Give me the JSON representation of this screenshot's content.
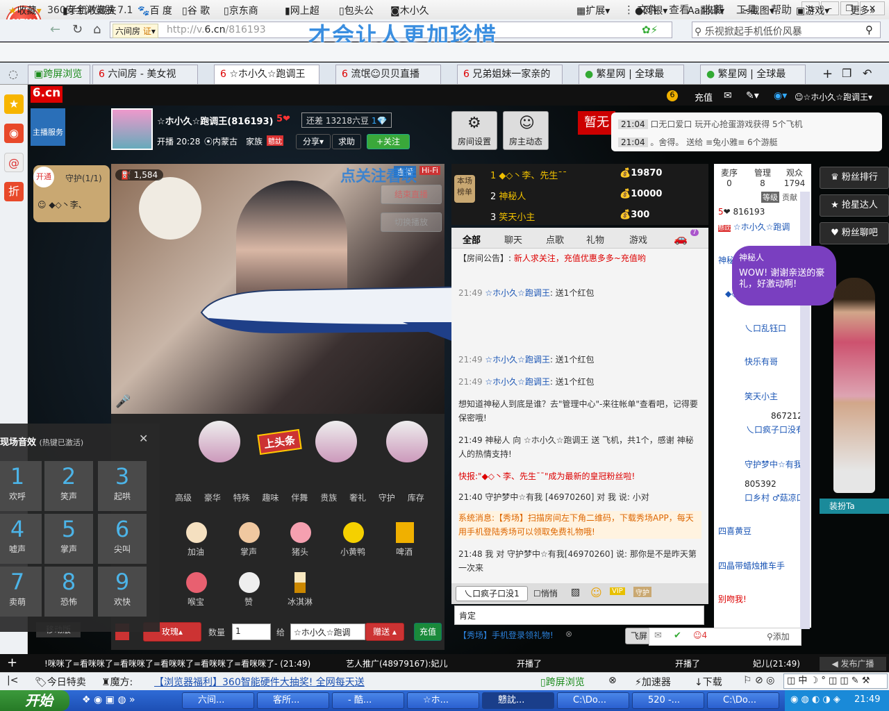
{
  "browser": {
    "title": "360安全浏览器 7.1",
    "logo": "NEW",
    "menus": [
      "文件",
      "查看",
      "收藏",
      "工具",
      "帮助"
    ],
    "url_prefix": "http://v.",
    "url_domain": "6.cn",
    "url_path": "/816193",
    "overlay_text": "才会让人更加珍惜",
    "badge": "六间房",
    "badge_cert": "证",
    "search_placeholder": "乐视掀起手机低价风暴"
  },
  "bookmarks": {
    "left": [
      "收藏",
      "手机收藏夹",
      "百 度",
      "谷 歌",
      "京东商",
      "网上超",
      "包头公",
      "木小久"
    ],
    "right": [
      "扩展",
      "网银",
      "翻译",
      "截图",
      "游戏",
      "更多"
    ]
  },
  "tabs": [
    {
      "label": "跨屏浏览"
    },
    {
      "label": "六间房 - 美女视"
    },
    {
      "label": "☆ホ小久☆跑调王"
    },
    {
      "label": "流氓☺贝贝直播"
    },
    {
      "label": "兄弟姐妹一家亲的"
    },
    {
      "label": "繁星网 | 全球最"
    },
    {
      "label": "繁星网 | 全球最"
    }
  ],
  "site": {
    "logo": "6.cn",
    "logo_sub": "六间房",
    "coin": "6",
    "topup": "充值",
    "user": "☆ホ小久☆跑调王",
    "anchor_service": "主播服务"
  },
  "host": {
    "name": "☆ホ小久☆跑调王(816193)",
    "level": "5",
    "gap_label": "还差",
    "gap_value": "13218",
    "gap_unit": "六豆",
    "gap_level": "1",
    "live_time": "开播 20:28",
    "location": "内蒙古",
    "family": "家族",
    "family_badge": "戆訦",
    "share": "分享",
    "help": "求助",
    "follow": "+关注",
    "room_settings": "房间设置",
    "host_feed": "房主动态"
  },
  "guard": {
    "open": "开通",
    "label": "守护(1/1)",
    "member": "◆◇丶李、"
  },
  "video": {
    "viewers": "1,584",
    "live": "直播",
    "hifi": "Hi-Fi",
    "follow_hint": "点关注看联",
    "btn1": "结束直播",
    "btn2": "切换播放"
  },
  "broadcast": {
    "badge": "暂无",
    "items": [
      {
        "time": "21:04",
        "text": "口无口爱口 玩开心抢蛋游戏获得 5个飞机"
      },
      {
        "time": "21:04",
        "text": "。舍得。 送给 ≡兔小雅≡ 6个游艇"
      }
    ]
  },
  "rank": {
    "label": "本场榜单",
    "rows": [
      {
        "rank": "1",
        "name": "◆◇丶李、先生¯¯",
        "score": "19870"
      },
      {
        "rank": "2",
        "name": "神秘人",
        "score": "10000"
      },
      {
        "rank": "3",
        "name": "笑天小主",
        "score": "300"
      }
    ]
  },
  "chat": {
    "tabs": [
      "全部",
      "聊天",
      "点歌",
      "礼物",
      "游戏"
    ],
    "car_count": "7",
    "notice_label": "【房间公告】:",
    "notice": "新人求关注，充值优惠多多~充值哟",
    "messages": [
      {
        "time": "21:49",
        "user": "☆ホ小久☆跑调王",
        "text": ": 送1个红包"
      },
      {
        "time": "21:49",
        "user": "☆ホ小久☆跑调王",
        "text": ": 送1个红包"
      },
      {
        "time": "21:49",
        "user": "☆ホ小久☆跑调王",
        "text": ": 送1个红包"
      }
    ],
    "sys1": "想知道神秘人到底是谁？去\"管理中心\"-来往帐单\"查看吧，记得要保密哦!",
    "gift_msg": "21:49  神秘人 向 ☆ホ小久☆跑调王 送 飞机，共1个，感谢 神秘人的热情支持!",
    "flash": "快报:\"◆◇丶李、先生¯¯\"成为最新的皇冠粉丝啦!",
    "m2": "21:40  守护梦中☆有我 [46970260] 对 我 说: 小对",
    "sys2": "系统消息:【秀场】扫描房间左下角二维码，下载秀场APP，每天用手机登陆秀场可以领取免费礼物哦!",
    "m3": "21:48  我 对 守护梦中☆有我[46970260] 说: 那你是不是昨天第一次来",
    "target": "乀口疯子口没1",
    "whisper": "悄悄",
    "input": "肯定",
    "promo": "【秀场】手机登录领礼物!",
    "send": "飞屏",
    "count": "4",
    "add": "添加"
  },
  "users": {
    "tabs": [
      {
        "label": "麦序",
        "count": "0"
      },
      {
        "label": "管理",
        "count": "8"
      },
      {
        "label": "观众",
        "count": "1794"
      }
    ],
    "level": "等级",
    "contrib": "贡献",
    "list": [
      {
        "lvl": "5",
        "name": "816193"
      },
      {
        "name": "☆ホ小久☆跑调"
      },
      {
        "name": "神秘人"
      },
      {
        "name": "◆◇丶李、先生"
      },
      {
        "name": "乀口乱钰口"
      },
      {
        "name": "快乐有哥"
      },
      {
        "name": "笑天小主"
      },
      {
        "name": "867212"
      },
      {
        "name": "乀口疯子口没有"
      },
      {
        "name": "守护梦中☆有我"
      },
      {
        "name": "805392"
      },
      {
        "name": "口乡村 ♂菇凉口"
      },
      {
        "name": "四喜黄豆"
      },
      {
        "name": "四晶带蜡烛推车手"
      },
      {
        "name": "别吻我!"
      }
    ]
  },
  "bubble": {
    "who": "神秘人",
    "text": "WOW! 谢谢亲送的豪礼，好激动啊!"
  },
  "fans": {
    "items": [
      "粉丝排行",
      "抢星达人",
      "粉丝聊吧"
    ],
    "dress": "装扮Ta"
  },
  "gifts": {
    "headline": "上头条",
    "cats": [
      "高级",
      "豪华",
      "特殊",
      "趣味",
      "伴舞",
      "贵族",
      "奢礼",
      "守护",
      "库存"
    ],
    "items": [
      {
        "name": "加油"
      },
      {
        "name": "掌声"
      },
      {
        "name": "猪头"
      },
      {
        "name": "小黄鸭"
      },
      {
        "name": "啤酒"
      },
      {
        "name": "喉宝"
      },
      {
        "name": "赞"
      },
      {
        "name": "冰淇淋"
      }
    ],
    "gift_sel": "玫瑰",
    "qty_label": "数量",
    "qty": "1",
    "to_label": "给",
    "to": "☆ホ小久☆跑调",
    "give": "赠送",
    "recharge": "充值",
    "mobile": "移动版"
  },
  "sfx": {
    "title": "现场音效",
    "hint": "(热键已激活)",
    "keys": [
      {
        "n": "1",
        "l": "欢呼"
      },
      {
        "n": "2",
        "l": "笑声"
      },
      {
        "n": "3",
        "l": "起哄"
      },
      {
        "n": "4",
        "l": "嘘声"
      },
      {
        "n": "5",
        "l": "掌声"
      },
      {
        "n": "6",
        "l": "尖叫"
      },
      {
        "n": "7",
        "l": "卖萌"
      },
      {
        "n": "8",
        "l": "恐怖"
      },
      {
        "n": "9",
        "l": "欢快"
      }
    ]
  },
  "marquee": {
    "text": "!咪咪了=看咪咪了=看咪咪了=看咪咪了=看咪咪了=看咪咪了- (21:49)",
    "promo": "艺人推广(48979167):妃儿",
    "s1": "开播了",
    "s2": "开播了",
    "s3": "妃儿(21:49)",
    "broadcast": "发布广播"
  },
  "status": {
    "deal": "今日特卖",
    "magic": "魔方:",
    "link": "【浏览器福利】360智能硬件大抽奖! 全网每天送",
    "cross": "跨屏浏览",
    "accel": "加速器",
    "download": "下载"
  },
  "taskbar": {
    "start": "开始",
    "items": [
      "六间...",
      "客所...",
      "- 酷...",
      "☆ホ...",
      "戆訦...",
      "C:\\Do...",
      "520 -...",
      "C:\\Do..."
    ],
    "clock": "21:49"
  }
}
